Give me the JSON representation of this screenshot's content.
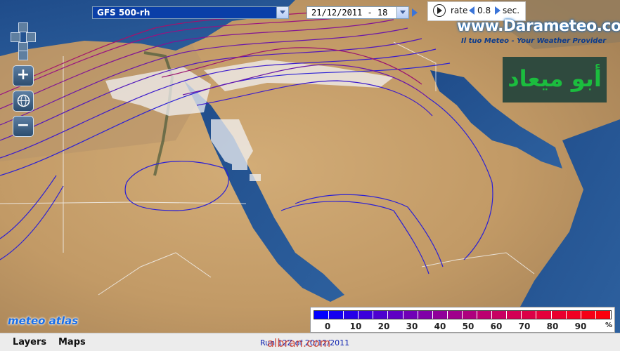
{
  "toolbar": {
    "model_value": "GFS 500-rh",
    "date_value": "21/12/2011 - 18",
    "rate_label": "rate",
    "rate_value": "0.8",
    "rate_unit": "sec."
  },
  "brand": {
    "name": "www.Darameteo.com",
    "tagline": "Il tuo Meteo - Your Weather Provider"
  },
  "overlay": {
    "arabic_text": "أبو ميعاد",
    "meteo_atlas": "meteo atlas"
  },
  "zoom": {
    "in_label": "+",
    "out_label": "−"
  },
  "legend": {
    "unit": "%",
    "ticks": [
      "0",
      "10",
      "20",
      "30",
      "40",
      "50",
      "60",
      "70",
      "80",
      "90"
    ],
    "colors": [
      "#0000ff",
      "#1500f0",
      "#2500e8",
      "#3a00dc",
      "#4d00d0",
      "#5f00c4",
      "#7000b6",
      "#8000a8",
      "#90009a",
      "#a0008c",
      "#ae007e",
      "#bc0070",
      "#c80062",
      "#d20054",
      "#dc0046",
      "#e4003a",
      "#ea002e",
      "#f00022",
      "#f50016",
      "#fa000c"
    ]
  },
  "footer": {
    "layers_label": "Layers",
    "maps_label": "Maps",
    "run_info": "Run 12Z of 20/12/2011",
    "watermark": "albran.com"
  },
  "colors": {
    "sea": "#2e5e9e",
    "desert": "#c4a06c",
    "contour_low": "#2a1fd6",
    "contour_high": "#a31560",
    "accent": "#0a3fa8"
  }
}
